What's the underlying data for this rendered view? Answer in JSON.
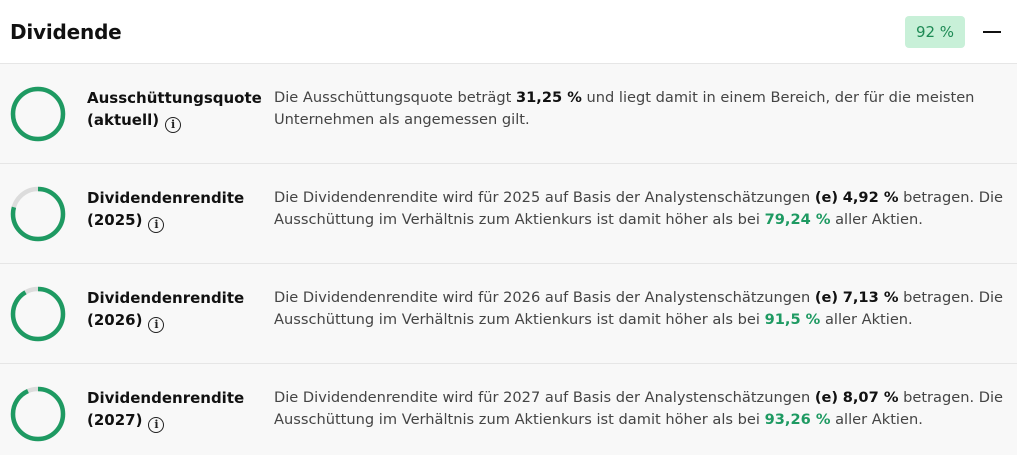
{
  "header": {
    "title": "Dividende",
    "score": "92 %"
  },
  "colors": {
    "ring_green": "#1e9a62",
    "ring_grey": "#dcdcdc",
    "badge_bg": "#c8f0d8"
  },
  "rows": [
    {
      "label_line1": "Ausschüttungsquote",
      "label_line2": "(aktuell)",
      "ring_fill": 1.0,
      "text_a": "Die Ausschüttungsquote beträgt ",
      "value": "31,25 %",
      "text_b": " und liegt damit in einem Bereich, der für die meisten Unternehmen als angemessen gilt."
    },
    {
      "label_line1": "Dividendenrendite",
      "label_line2": "(2025)",
      "ring_fill": 0.7924,
      "text_a": "Die Dividendenrendite wird für 2025 auf Basis der Analystenschätzungen ",
      "estimate": "(e)",
      "value": "4,92 %",
      "text_b": " betragen. Die Ausschüttung im Verhältnis zum Aktienkurs ist damit höher als bei ",
      "percentile": "79,24 %",
      "text_c": " aller Aktien."
    },
    {
      "label_line1": "Dividendenrendite",
      "label_line2": "(2026)",
      "ring_fill": 0.915,
      "text_a": "Die Dividendenrendite wird für 2026 auf Basis der Analystenschätzungen ",
      "estimate": "(e)",
      "value": "7,13 %",
      "text_b": " betragen. Die Ausschüttung im Verhältnis zum Aktienkurs ist damit höher als bei ",
      "percentile": "91,5 %",
      "text_c": " aller Aktien."
    },
    {
      "label_line1": "Dividendenrendite",
      "label_line2": "(2027)",
      "ring_fill": 0.9326,
      "text_a": "Die Dividendenrendite wird für 2027 auf Basis der Analystenschätzungen ",
      "estimate": "(e)",
      "value": "8,07 %",
      "text_b": " betragen. Die Ausschüttung im Verhältnis zum Aktienkurs ist damit höher als bei ",
      "percentile": "93,26 %",
      "text_c": " aller Aktien."
    }
  ]
}
